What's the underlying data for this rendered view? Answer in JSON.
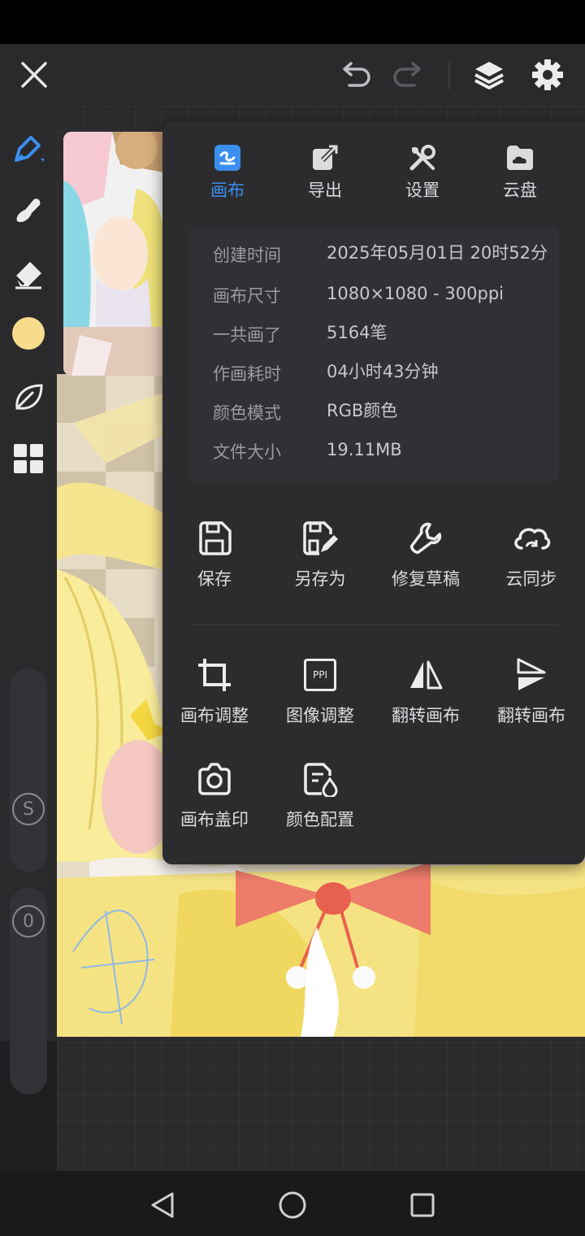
{
  "colors": {
    "accent": "#3b8ff0",
    "current_color": "#f6dc8c",
    "panel_bg": "#2c2c2f"
  },
  "top_bar": {
    "icons": [
      "close-icon",
      "undo-icon",
      "redo-icon",
      "layers-icon",
      "gear-icon"
    ]
  },
  "left_toolbar": {
    "tools": [
      "pen-icon",
      "smudge-icon",
      "eraser-icon",
      "color-swatch",
      "leaf-icon",
      "grid-icon"
    ],
    "size_slider_label": "S",
    "opacity_slider_label": "0"
  },
  "panel": {
    "tabs": [
      {
        "label": "画布",
        "icon": "canvas-icon",
        "active": true
      },
      {
        "label": "导出",
        "icon": "export-icon",
        "active": false
      },
      {
        "label": "设置",
        "icon": "settings-tools-icon",
        "active": false
      },
      {
        "label": "云盘",
        "icon": "cloud-drive-icon",
        "active": false
      }
    ],
    "info": [
      {
        "key": "创建时间",
        "value": "2025年05月01日 20时52分"
      },
      {
        "key": "画布尺寸",
        "value": "1080×1080 - 300ppi"
      },
      {
        "key": "一共画了",
        "value": "5164笔"
      },
      {
        "key": "作画耗时",
        "value": "04小时43分钟"
      },
      {
        "key": "颜色模式",
        "value": "RGB颜色"
      },
      {
        "key": "文件大小",
        "value": "19.11MB"
      }
    ],
    "actions_row1": [
      {
        "label": "保存",
        "icon": "save-icon"
      },
      {
        "label": "另存为",
        "icon": "save-as-icon"
      },
      {
        "label": "修复草稿",
        "icon": "wrench-icon"
      },
      {
        "label": "云同步",
        "icon": "cloud-sync-icon"
      }
    ],
    "actions_row2": [
      {
        "label": "画布调整",
        "icon": "crop-icon"
      },
      {
        "label": "图像调整",
        "icon": "ppi-icon",
        "icon_text": "PPI"
      },
      {
        "label": "翻转画布",
        "icon": "flip-horizontal-icon"
      },
      {
        "label": "翻转画布",
        "icon": "flip-vertical-icon"
      }
    ],
    "actions_row3": [
      {
        "label": "画布盖印",
        "icon": "camera-icon"
      },
      {
        "label": "颜色配置",
        "icon": "color-profile-icon"
      }
    ]
  },
  "nav_bar": {
    "icons": [
      "back-icon",
      "home-icon",
      "recents-icon"
    ]
  }
}
